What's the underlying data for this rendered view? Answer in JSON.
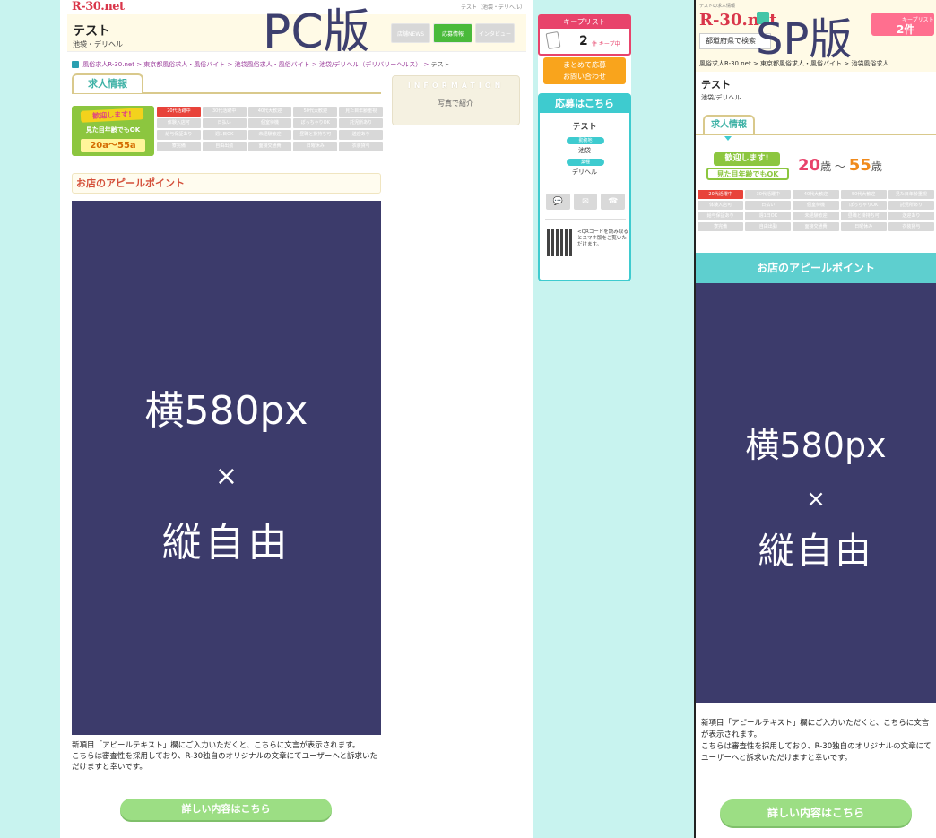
{
  "labels": {
    "pc": "PC版",
    "sp": "SP版"
  },
  "brand": "R-30.net",
  "pc": {
    "top_link": "テスト（池袋・デリヘル）",
    "shop_name": "テスト",
    "shop_sub": "池袋・デリヘル",
    "tabs": [
      "店舗NEWS",
      "応募情報",
      "インタビュー"
    ],
    "breadcrumb": {
      "links": [
        "風俗求人R-30.net",
        "東京都風俗求人・風俗バイト",
        "池袋風俗求人・風俗バイト",
        "池袋/デリヘル（デリバリーヘルス）"
      ],
      "current": "テスト"
    },
    "jobs_tab": "求人情報",
    "welcome": {
      "line1": "歓迎します!",
      "line2": "見た目年齢でもOK",
      "ages": "20a～55a"
    },
    "tags": [
      "20代活躍中",
      "30代活躍中",
      "40代大歓迎",
      "50代大歓迎",
      "見た目年齢重視",
      "体験入店可",
      "日払い",
      "個室待機",
      "ぽっちゃりOK",
      "託児所あり",
      "給与保証あり",
      "週1日OK",
      "未経験歓迎",
      "昼職と掛持ち可",
      "送迎あり",
      "寮完備",
      "自由出勤",
      "面接交通費",
      "日曜休み",
      "衣装貸与"
    ],
    "info_title": "INFORMATION",
    "photo_intro": "写真で紹介",
    "appeal_title": "お店のアピールポイント",
    "placeholder": {
      "line1": "横580px",
      "line2": "×",
      "line3": "縦自由"
    },
    "appeal_text": "新項目「アピールテキスト」欄にご入力いただくと、こちらに文言が表示されます。\nこちらは審査性を採用しており、R-30独自のオリジナルの文章にてユーザーへと訴求いただけますと幸いです。",
    "detail_button": "詳しい内容はこちら"
  },
  "sidebar": {
    "keep_label": "キープリスト",
    "keep_count": "2",
    "keep_unit": "件 キープ中",
    "bulk_line1": "まとめて応募",
    "bulk_line2": "お問い合わせ",
    "apply_title": "応募はこちら",
    "shop_name": "テスト",
    "area_label": "勤務地",
    "area_value": "池袋",
    "type_label": "業種",
    "type_value": "デリヘル",
    "contact_icons": [
      "line-icon",
      "mail-icon",
      "phone-icon"
    ],
    "qr_text": "<QRコードを読み取るとスマホ版をご覧いただけます。"
  },
  "sp": {
    "top_line": "テストの求人情報",
    "search_placeholder": "都道府県で検索",
    "keep_label": "キープリスト",
    "keep_count": "2件",
    "breadcrumb": "風俗求人R-30.net > 東京都風俗求人・風俗バイト > 池袋風俗求人",
    "shop_name": "テスト",
    "shop_sub": "池袋/デリヘル",
    "jobs_tab": "求人情報",
    "welcome_1": "歓迎します!",
    "welcome_2": "見た目年齢でもOK",
    "age_from": "20",
    "age_from_unit": "歳",
    "age_sep": "～",
    "age_to": "55",
    "age_to_unit": "歳",
    "appeal_title": "お店のアピールポイント",
    "placeholder": {
      "line1": "横580px",
      "line2": "×",
      "line3": "縦自由"
    },
    "appeal_text": "新項目「アピールテキスト」欄にご入力いただくと、こちらに文言が表示されます。\nこちらは審査性を採用しており、R-30独自のオリジナルの文章にてユーザーへと訴求いただけますと幸いです。",
    "detail_button": "詳しい内容はこちら"
  },
  "colors": {
    "mint": "#c8f3ef",
    "purple": "#3c3b6b",
    "accent_pink": "#e8436b",
    "teal": "#3ecbcf",
    "green": "#9cde84"
  }
}
